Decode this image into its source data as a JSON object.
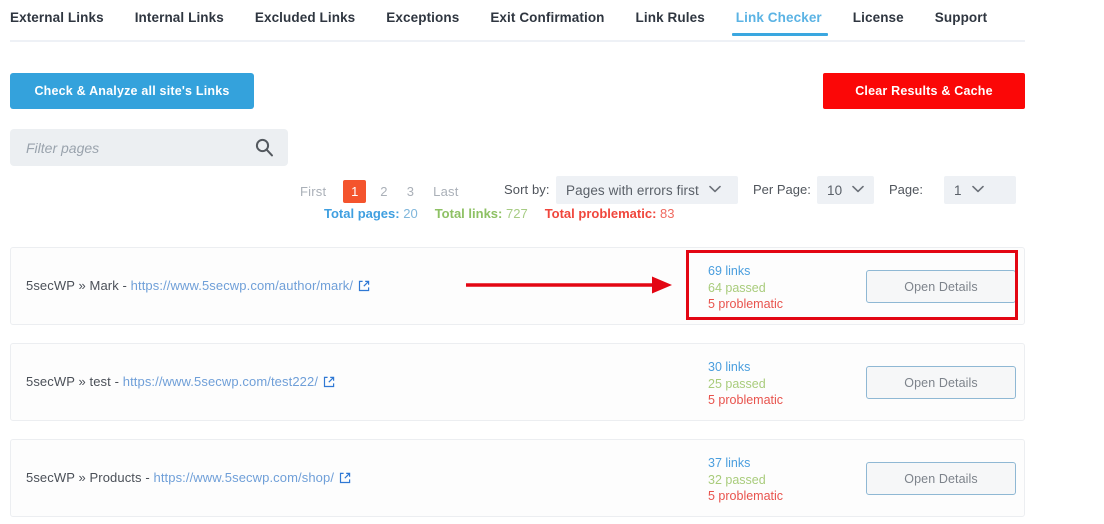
{
  "tabs": [
    {
      "label": "External Links",
      "active": false
    },
    {
      "label": "Internal Links",
      "active": false
    },
    {
      "label": "Excluded Links",
      "active": false
    },
    {
      "label": "Exceptions",
      "active": false
    },
    {
      "label": "Exit Confirmation",
      "active": false
    },
    {
      "label": "Link Rules",
      "active": false
    },
    {
      "label": "Link Checker",
      "active": true
    },
    {
      "label": "License",
      "active": false
    },
    {
      "label": "Support",
      "active": false
    }
  ],
  "toolbar": {
    "check_label": "Check & Analyze all site's Links",
    "clear_label": "Clear Results & Cache",
    "check_color": "#34a2dc",
    "clear_color": "#fb0707"
  },
  "filter": {
    "placeholder": "Filter pages",
    "value": "",
    "icon": "search-icon"
  },
  "pager": {
    "first_label": "First",
    "pages": [
      "1",
      "2",
      "3"
    ],
    "current_page": "1",
    "last_label": "Last",
    "current_color": "#f4542d"
  },
  "controls": {
    "sort_label": "Sort by:",
    "sort_value": "Pages with errors first",
    "per_page_label": "Per Page:",
    "per_page_value": "10",
    "page_label": "Page:",
    "page_value": "1",
    "chevron": "chevron-down-icon"
  },
  "totals": {
    "pages_label": "Total pages:",
    "pages_value": "20",
    "links_label": "Total links:",
    "links_value": "727",
    "problematic_label": "Total problematic:",
    "problematic_value": "83"
  },
  "rows": [
    {
      "title": "5secWP » Mark - ",
      "url": "https://www.5secwp.com/author/mark/",
      "links": "69 links",
      "passed": "64 passed",
      "problematic": "5 problematic",
      "details_label": "Open Details",
      "highlighted": true
    },
    {
      "title": "5secWP » test - ",
      "url": "https://www.5secwp.com/test222/",
      "links": "30 links",
      "passed": "25 passed",
      "problematic": "5 problematic",
      "details_label": "Open Details",
      "highlighted": false
    },
    {
      "title": "5secWP » Products - ",
      "url": "https://www.5secwp.com/shop/",
      "links": "37 links",
      "passed": "32 passed",
      "problematic": "5 problematic",
      "details_label": "Open Details",
      "highlighted": false
    }
  ],
  "annotations": {
    "highlight_color": "#e30613",
    "arrow_color": "#e30613"
  }
}
